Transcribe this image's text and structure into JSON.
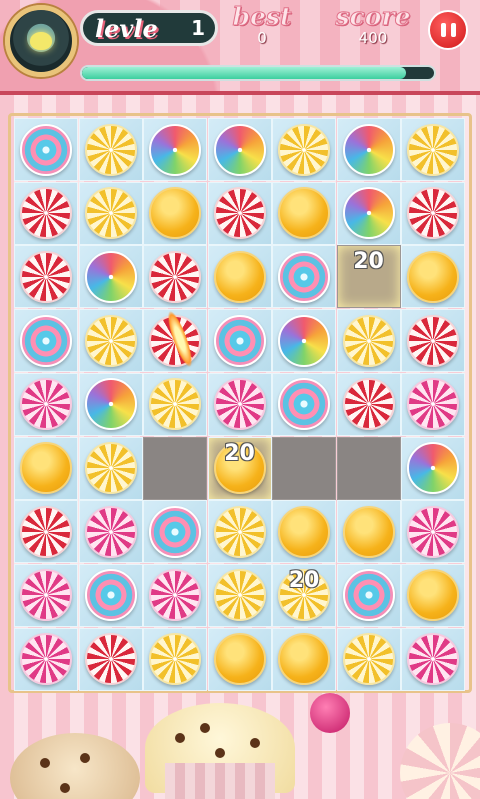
{
  "header": {
    "level_label": "levle",
    "level_value": "1",
    "best_label": "best",
    "best_value": "0",
    "score_label": "score",
    "score_value": "400",
    "progress_fraction": 0.92
  },
  "board": {
    "rows": 9,
    "cols": 7,
    "grid": [
      [
        "blue",
        "yellow",
        "rainbow",
        "rainbow",
        "yellow",
        "rainbow",
        "yellow"
      ],
      [
        "red",
        "yellow",
        "orange",
        "red",
        "orange",
        "rainbow",
        "red"
      ],
      [
        "red",
        "rainbow",
        "red",
        "orange",
        "blue",
        "empty-hl",
        "orange"
      ],
      [
        "blue",
        "yellow",
        "red",
        "blue",
        "rainbow",
        "yellow",
        "red"
      ],
      [
        "pink",
        "rainbow",
        "yellow",
        "pink",
        "blue",
        "red",
        "pink"
      ],
      [
        "orange",
        "yellow",
        "empty",
        "orange-hl",
        "empty",
        "empty",
        "rainbow"
      ],
      [
        "red",
        "pink",
        "blue",
        "yellow",
        "orange",
        "orange",
        "pink"
      ],
      [
        "pink",
        "blue",
        "pink",
        "yellow",
        "yellow",
        "blue",
        "orange"
      ],
      [
        "pink",
        "red",
        "yellow",
        "orange",
        "orange",
        "yellow",
        "pink"
      ]
    ],
    "points_popups": [
      {
        "text": "20",
        "row": 2,
        "col": 5
      },
      {
        "text": "20",
        "row": 5,
        "col": 3
      },
      {
        "text": "20",
        "row": 7,
        "col": 4
      }
    ]
  }
}
